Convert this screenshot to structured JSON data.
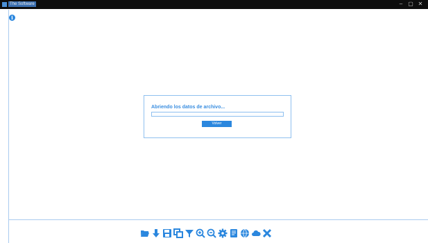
{
  "window": {
    "title": "The Software",
    "controls": [
      "–",
      "▢",
      "✕"
    ]
  },
  "dialog": {
    "message": "Abriendo los datos de archivo...",
    "progress": 0,
    "button_label": "Volver"
  },
  "toolbar": {
    "icons": [
      "folder-open-icon",
      "download-icon",
      "save-icon",
      "clone-icon",
      "filter-icon",
      "zoom-in-icon",
      "zoom-out-icon",
      "settings-icon",
      "document-icon",
      "globe-icon",
      "cloud-icon",
      "close-icon"
    ]
  },
  "colors": {
    "accent": "#2b87de",
    "border": "#a9cbef",
    "titlebar": "#0d0d0d"
  }
}
